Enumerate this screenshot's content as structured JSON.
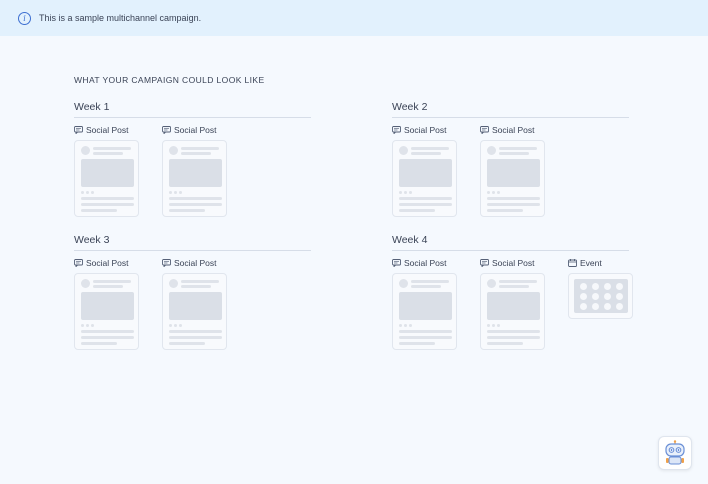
{
  "banner": {
    "text": "This is a sample multichannel campaign.",
    "icon": "info-icon"
  },
  "heading": "WHAT YOUR CAMPAIGN COULD LOOK LIKE",
  "weeks": [
    {
      "title": "Week 1",
      "items": [
        {
          "label": "Social Post",
          "icon": "social-post-icon"
        },
        {
          "label": "Social Post",
          "icon": "social-post-icon"
        }
      ]
    },
    {
      "title": "Week 2",
      "items": [
        {
          "label": "Social Post",
          "icon": "social-post-icon"
        },
        {
          "label": "Social Post",
          "icon": "social-post-icon"
        }
      ]
    },
    {
      "title": "Week 3",
      "items": [
        {
          "label": "Social Post",
          "icon": "social-post-icon"
        },
        {
          "label": "Social Post",
          "icon": "social-post-icon"
        }
      ]
    },
    {
      "title": "Week 4",
      "items": [
        {
          "label": "Social Post",
          "icon": "social-post-icon"
        },
        {
          "label": "Social Post",
          "icon": "social-post-icon"
        },
        {
          "label": "Event",
          "icon": "calendar-icon"
        }
      ]
    }
  ],
  "assistant": {
    "icon": "robot-icon"
  },
  "colors": {
    "banner_bg": "#e2f1fd",
    "accent": "#3d6fd1",
    "page_bg": "#f5f9fe"
  }
}
